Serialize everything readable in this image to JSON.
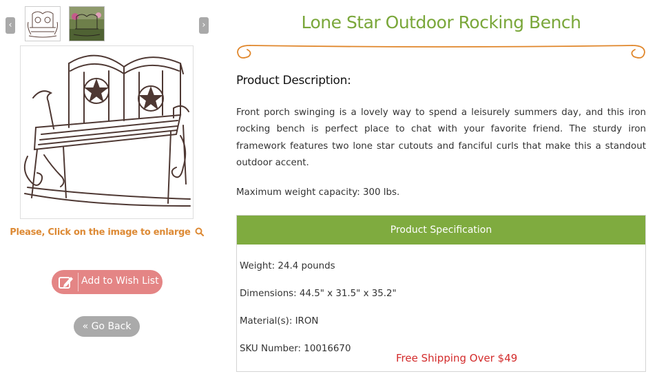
{
  "gallery": {
    "prev_icon": "chevron-left-icon",
    "next_icon": "chevron-right-icon",
    "prev_symbol": "‹",
    "next_symbol": "›",
    "enlarge_hint": "Please, Click on the image to enlarge",
    "hint_color": "#dd8a35"
  },
  "actions": {
    "wishlist_label": "Add to Wish List",
    "wishlist_icon": "edit-icon",
    "wishlist_color": "#e48585",
    "back_label": "« Go Back",
    "back_color": "#aaaaaa"
  },
  "product": {
    "title": "Lone Star Outdoor Rocking Bench",
    "title_color": "#7aa73a",
    "description_heading": "Product Description:",
    "description": "Front porch swinging is a lovely way to spend a leisurely summers day, and this iron rocking bench is perfect place to chat with your favorite friend. The sturdy iron framework features two lone star cutouts and fanciful curls that make this a standout outdoor accent.",
    "max_weight": "Maximum weight capacity: 300 lbs."
  },
  "specifications": {
    "header": "Product  Specification",
    "header_color": "#7fab3f",
    "weight": "Weight: 24.4 pounds",
    "dimensions": "Dimensions: 44.5\" x 31.5\" x 35.2\"",
    "material": "Material(s): IRON",
    "sku": "SKU Number: 10016670"
  },
  "shipping": {
    "free_shipping": "Free Shipping Over $49",
    "color": "#d32b2b"
  }
}
